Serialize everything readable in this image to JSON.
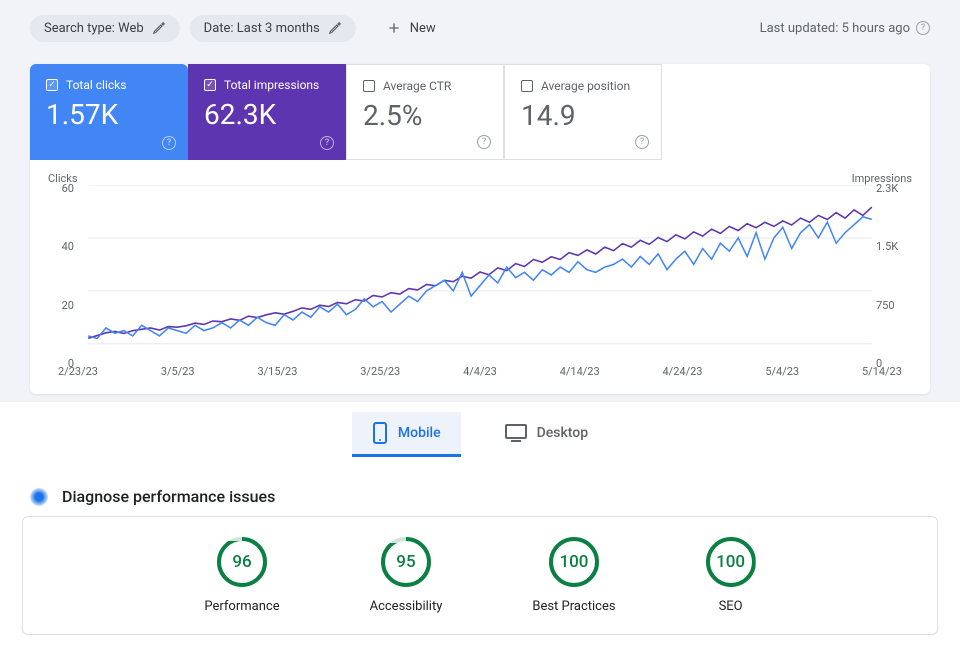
{
  "filters": {
    "search_type_chip": "Search type: Web",
    "date_chip": "Date: Last 3 months",
    "new_label": "New"
  },
  "last_updated": "Last updated: 5 hours ago",
  "metrics": {
    "clicks": {
      "label": "Total clicks",
      "value": "1.57K",
      "checked": true
    },
    "impressions": {
      "label": "Total impressions",
      "value": "62.3K",
      "checked": true
    },
    "ctr": {
      "label": "Average CTR",
      "value": "2.5%",
      "checked": false
    },
    "position": {
      "label": "Average position",
      "value": "14.9",
      "checked": false
    }
  },
  "chart_data": {
    "type": "line",
    "left_axis_label": "Clicks",
    "right_axis_label": "Impressions",
    "ylim_left": [
      0,
      60
    ],
    "ylim_right": [
      0,
      2300
    ],
    "y_ticks_left": [
      "60",
      "40",
      "20",
      "0"
    ],
    "y_ticks_right": [
      "2.3K",
      "1.5K",
      "750",
      "0"
    ],
    "categories": [
      "2/23/23",
      "3/5/23",
      "3/15/23",
      "3/25/23",
      "4/4/23",
      "4/14/23",
      "4/24/23",
      "5/4/23",
      "5/14/23"
    ],
    "series": [
      {
        "name": "Clicks",
        "color": "#4285f4",
        "values": [
          3,
          2,
          6,
          4,
          5,
          3,
          7,
          5,
          3,
          6,
          5,
          4,
          7,
          5,
          6,
          8,
          6,
          9,
          7,
          10,
          8,
          7,
          11,
          9,
          12,
          10,
          14,
          12,
          15,
          11,
          13,
          17,
          14,
          16,
          12,
          15,
          18,
          16,
          20,
          22,
          24,
          20,
          27,
          18,
          22,
          26,
          23,
          29,
          25,
          27,
          24,
          28,
          26,
          29,
          27,
          31,
          28,
          27,
          29,
          30,
          32,
          29,
          33,
          30,
          34,
          28,
          32,
          35,
          30,
          36,
          32,
          38,
          35,
          40,
          33,
          42,
          32,
          40,
          44,
          36,
          42,
          45,
          40,
          46,
          38,
          42,
          45,
          48,
          47
        ]
      },
      {
        "name": "Impressions",
        "color": "#5e35b1",
        "values": [
          80,
          120,
          160,
          180,
          150,
          190,
          210,
          230,
          200,
          250,
          240,
          260,
          300,
          280,
          330,
          320,
          360,
          340,
          400,
          380,
          420,
          450,
          430,
          470,
          520,
          500,
          560,
          540,
          600,
          580,
          640,
          620,
          700,
          680,
          740,
          720,
          800,
          780,
          860,
          840,
          920,
          900,
          980,
          950,
          1040,
          1000,
          1100,
          1060,
          1160,
          1120,
          1220,
          1180,
          1260,
          1220,
          1320,
          1280,
          1360,
          1300,
          1400,
          1350,
          1450,
          1400,
          1500,
          1440,
          1540,
          1480,
          1580,
          1520,
          1620,
          1560,
          1660,
          1600,
          1700,
          1640,
          1740,
          1680,
          1760,
          1700,
          1780,
          1720,
          1820,
          1760,
          1860,
          1800,
          1900,
          1820,
          1940,
          1860,
          1980
        ]
      }
    ]
  },
  "tabs": {
    "mobile": "Mobile",
    "desktop": "Desktop"
  },
  "diagnose_heading": "Diagnose performance issues",
  "lighthouse": {
    "performance": {
      "score": "96",
      "label": "Performance"
    },
    "accessibility": {
      "score": "95",
      "label": "Accessibility"
    },
    "best_practices": {
      "score": "100",
      "label": "Best Practices"
    },
    "seo": {
      "score": "100",
      "label": "SEO"
    }
  }
}
